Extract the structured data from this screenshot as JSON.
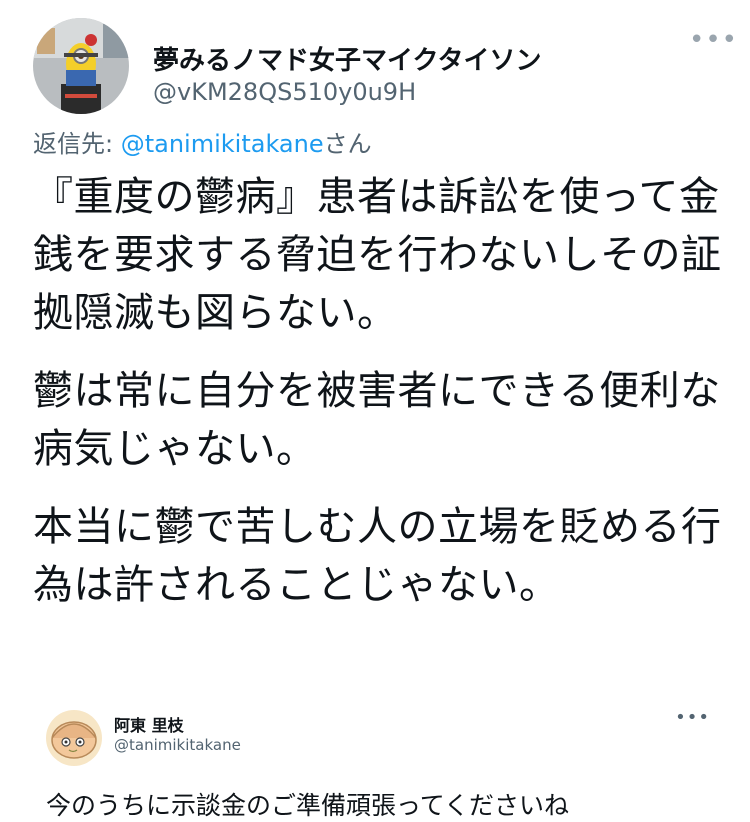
{
  "tweet": {
    "author_name": "夢みるノマド女子マイクタイソン",
    "author_handle": "@vKM28QS510y0u9H",
    "more_label": "•••",
    "reply_prefix": "返信先: ",
    "reply_to": "@tanimikitakane",
    "reply_suffix": "さん",
    "paragraphs": [
      "『重度の鬱病』患者は訴訟を使って金銭を要求する脅迫を行わないしその証拠隠滅も図らない。",
      "鬱は常に自分を被害者にできる便利な病気じゃない。",
      "本当に鬱で苦しむ人の立場を貶める行為は許されることじゃない。"
    ]
  },
  "quoted": {
    "author_name": "阿東 里枝",
    "author_handle": "@tanimikitakane",
    "more_label": "•••",
    "text": "今のうちに示談金のご準備頑張ってくださいね"
  },
  "colors": {
    "text": "#0f1419",
    "secondary": "#536471",
    "link": "#1d9bf0"
  },
  "icons": {
    "main_avatar": "minion-figure-avatar",
    "quoted_avatar": "cartoon-face-avatar",
    "more": "more-horizontal-icon"
  }
}
